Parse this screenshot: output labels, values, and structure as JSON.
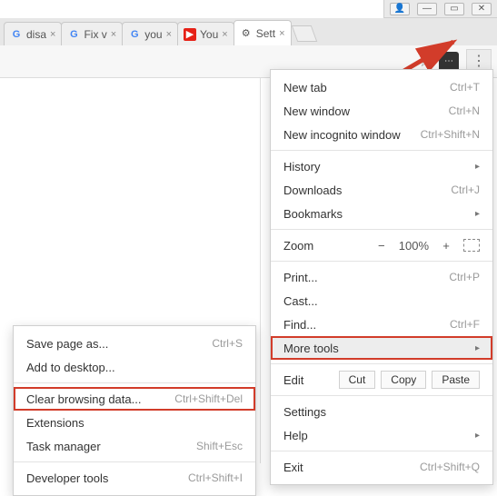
{
  "window_controls": {
    "user": "👤",
    "min": "—",
    "max": "▭",
    "close": "✕"
  },
  "tabs": [
    {
      "icon": "G",
      "title": "disa",
      "kind": "g"
    },
    {
      "icon": "G",
      "title": "Fix v",
      "kind": "g"
    },
    {
      "icon": "G",
      "title": "you",
      "kind": "g"
    },
    {
      "icon": "▶",
      "title": "You",
      "kind": "yt"
    },
    {
      "icon": "⚙",
      "title": "Sett",
      "kind": "gear",
      "active": true
    }
  ],
  "toolbar": {
    "star_icon": "☆",
    "ext_icon": "⋯",
    "menu_icon": "⋮"
  },
  "menu": {
    "new_tab": {
      "label": "New tab",
      "shortcut": "Ctrl+T"
    },
    "new_window": {
      "label": "New window",
      "shortcut": "Ctrl+N"
    },
    "incognito": {
      "label": "New incognito window",
      "shortcut": "Ctrl+Shift+N"
    },
    "history": {
      "label": "History"
    },
    "downloads": {
      "label": "Downloads",
      "shortcut": "Ctrl+J"
    },
    "bookmarks": {
      "label": "Bookmarks"
    },
    "zoom_label": "Zoom",
    "zoom_minus": "−",
    "zoom_value": "100%",
    "zoom_plus": "+",
    "print": {
      "label": "Print...",
      "shortcut": "Ctrl+P"
    },
    "cast": {
      "label": "Cast..."
    },
    "find": {
      "label": "Find...",
      "shortcut": "Ctrl+F"
    },
    "more_tools": {
      "label": "More tools"
    },
    "edit_label": "Edit",
    "cut": "Cut",
    "copy": "Copy",
    "paste": "Paste",
    "settings": {
      "label": "Settings"
    },
    "help": {
      "label": "Help"
    },
    "exit": {
      "label": "Exit",
      "shortcut": "Ctrl+Shift+Q"
    }
  },
  "submenu": {
    "save_page": {
      "label": "Save page as...",
      "shortcut": "Ctrl+S"
    },
    "add_desktop": {
      "label": "Add to desktop..."
    },
    "clear_data": {
      "label": "Clear browsing data...",
      "shortcut": "Ctrl+Shift+Del"
    },
    "extensions": {
      "label": "Extensions"
    },
    "task_mgr": {
      "label": "Task manager",
      "shortcut": "Shift+Esc"
    },
    "dev_tools": {
      "label": "Developer tools",
      "shortcut": "Ctrl+Shift+I"
    }
  },
  "highlight_color": "#d23c2a"
}
